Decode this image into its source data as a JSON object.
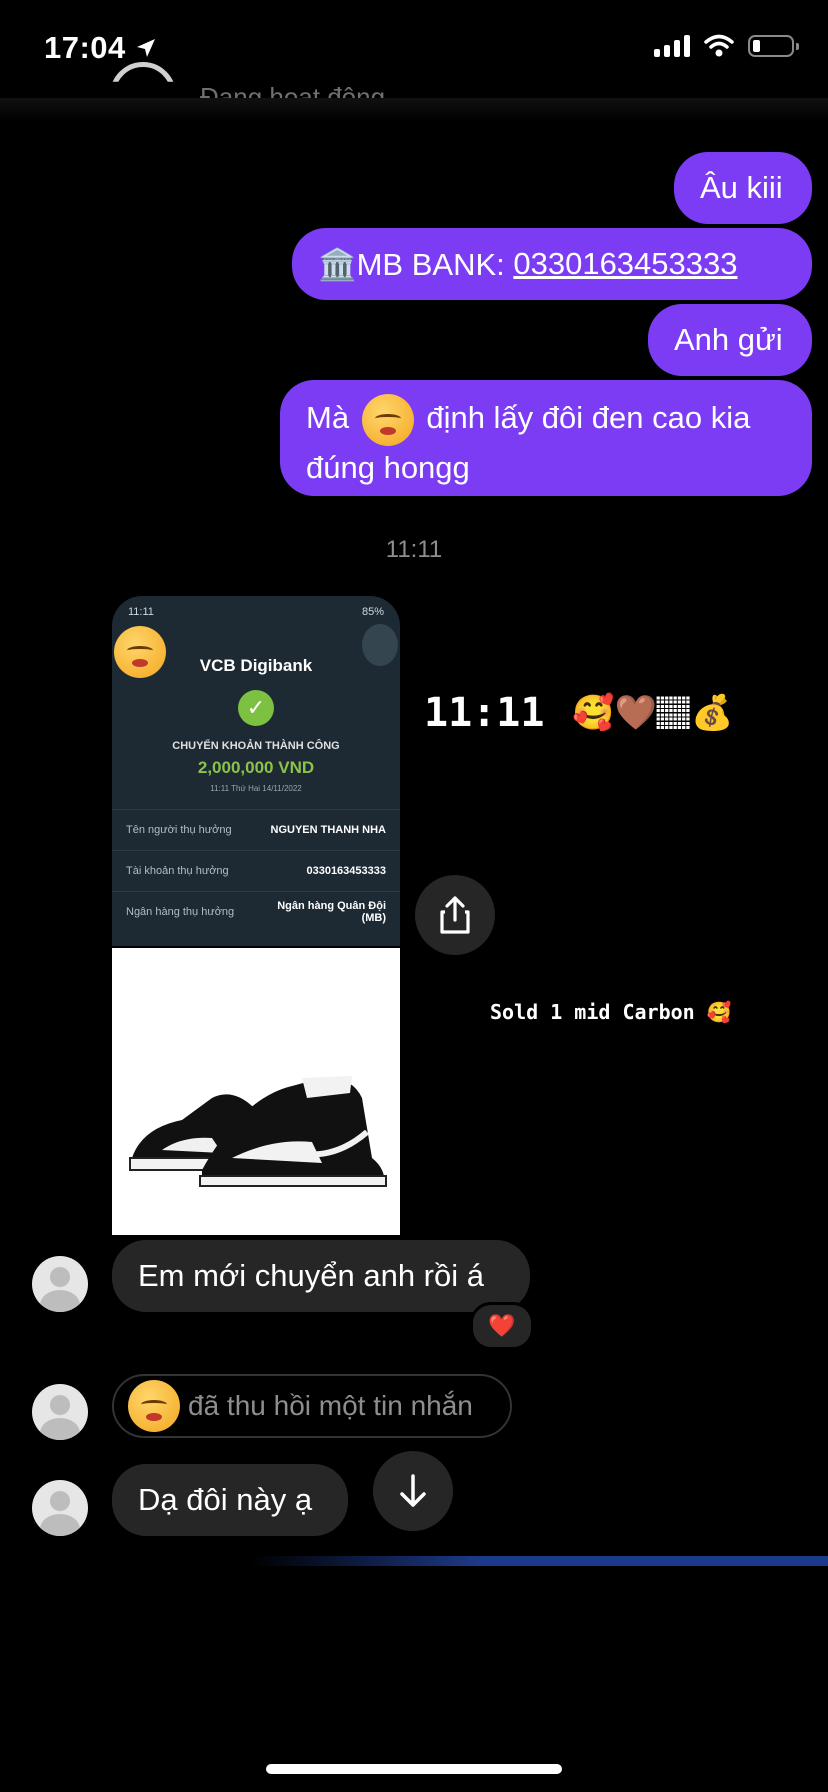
{
  "status_bar": {
    "time": "17:04"
  },
  "header": {
    "status_text": "Đang hoạt động"
  },
  "messages_out": [
    {
      "text": "Âu kiii"
    },
    {
      "prefix": "🏛️MB BANK: ",
      "link": "0330163453333"
    },
    {
      "text": "Anh gửi"
    },
    {
      "line1_a": "Mà",
      "line1_b": "định lấy đôi đen cao kia",
      "line2": "đúng hongg"
    }
  ],
  "timestamp": "11:11",
  "story": {
    "caption": "11:11",
    "caption_emojis": "🥰🤎🏽💰",
    "shoe_caption": "Sold 1 mid Carbon 🥰"
  },
  "bank_receipt": {
    "time": "11:11",
    "battery": "85%",
    "logo": "VCB Digibank",
    "status": "CHUYỂN KHOẢN THÀNH CÔNG",
    "amount": "2,000,000 VND",
    "datetime": "11:11 Thứ Hai 14/11/2022",
    "rows": [
      {
        "k": "Tên người thụ hưởng",
        "v": "NGUYEN THANH NHA"
      },
      {
        "k": "Tài khoản thụ hưởng",
        "v": "0330163453333"
      },
      {
        "k": "Ngân hàng thụ hưởng",
        "v": "Ngân hàng Quân Đội (MB)"
      }
    ]
  },
  "messages_in": [
    {
      "text": "Em mới chuyển anh rồi á",
      "reaction": "❤️"
    },
    {
      "text": "đã thu hồi một tin nhắn"
    },
    {
      "text": "Dạ đôi này ạ"
    }
  ],
  "colors": {
    "outgoing": "#7b3cf4",
    "incoming": "#262626",
    "background": "#000000"
  }
}
